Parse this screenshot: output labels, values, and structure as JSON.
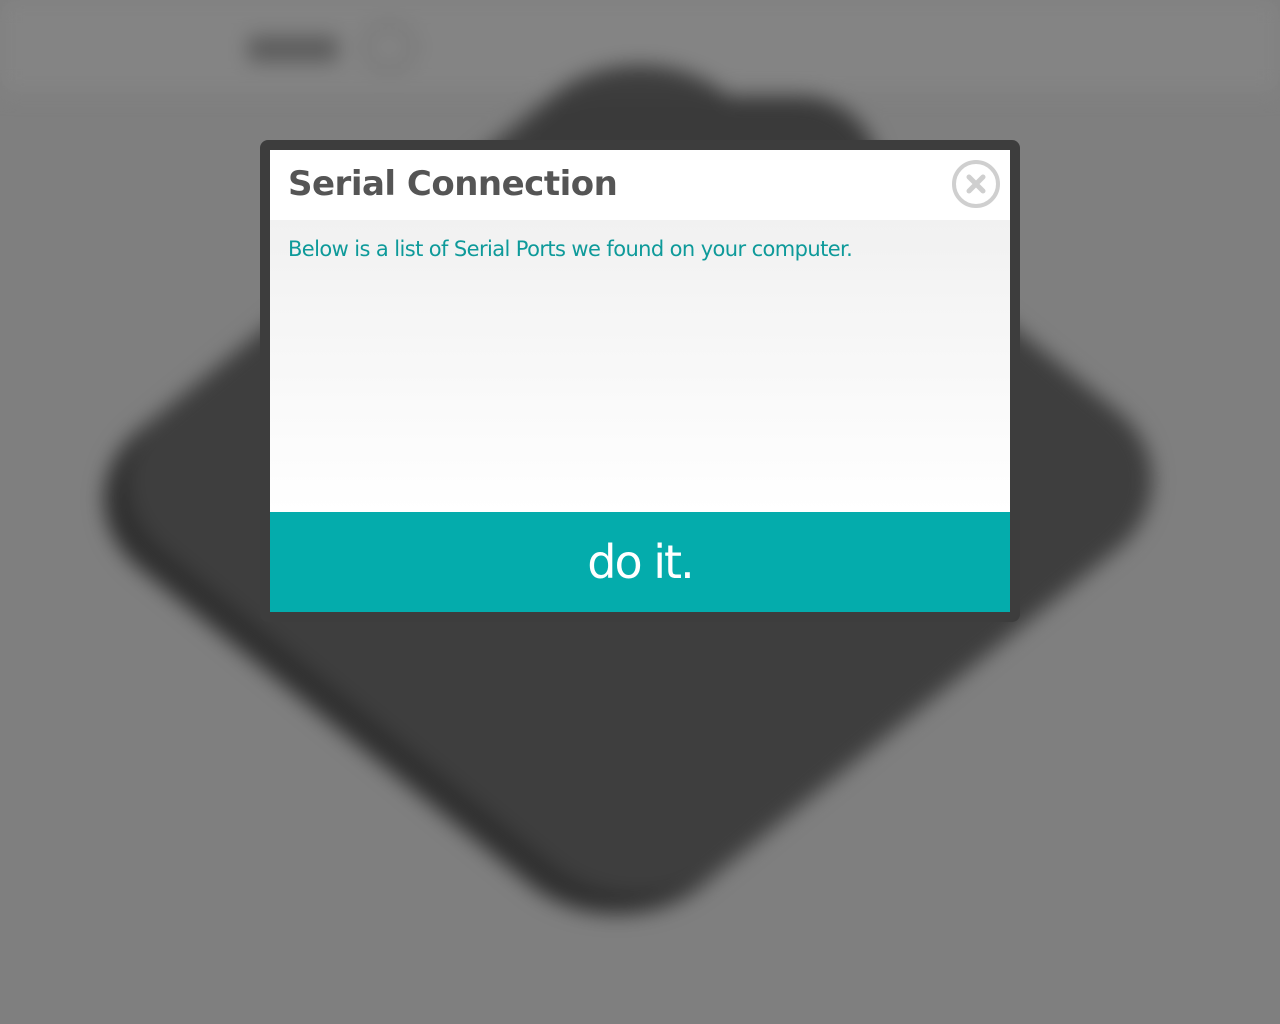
{
  "modal": {
    "title": "Serial Connection",
    "description": "Below is a list of Serial Ports we found on your computer.",
    "ports": [],
    "action_label": "do it.",
    "close_icon": "close-circle-icon"
  },
  "colors": {
    "accent": "#04acac",
    "description_text": "#0e9a9a",
    "title_text": "#555555",
    "overlay_background": "#7f7f7f",
    "frame": "#3d3d3d"
  }
}
